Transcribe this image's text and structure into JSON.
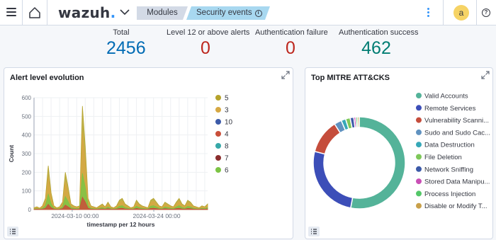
{
  "header": {
    "logo_text": "wazuh",
    "logo_dot": ".",
    "breadcrumbs": [
      "Modules",
      "Security events"
    ],
    "info_glyph": "i",
    "avatar_initial": "a",
    "help_glyph": "?",
    "brand_color": "#3595f9"
  },
  "stats": [
    {
      "label": "Total",
      "value": "2456",
      "color": "#006bb4"
    },
    {
      "label": "Level 12 or above alerts",
      "value": "0",
      "color": "#bd271e"
    },
    {
      "label": "Authentication failure",
      "value": "0",
      "color": "#bd271e"
    },
    {
      "label": "Authentication success",
      "value": "462",
      "color": "#017d73"
    }
  ],
  "alert_panel": {
    "title": "Alert level evolution"
  },
  "mitre_panel": {
    "title": "Top MITRE ATT&CKS"
  },
  "chart_data": [
    {
      "type": "area",
      "title": "Alert level evolution",
      "xlabel": "timestamp per 12 hours",
      "ylabel": "Count",
      "ylim": [
        0,
        600
      ],
      "y_ticks": [
        0,
        100,
        200,
        300,
        400,
        500,
        600
      ],
      "x_tick_labels": [
        "2024-03-10 00:00",
        "2024-03-24 00:00"
      ],
      "grid": true,
      "legend_position": "right",
      "legend": [
        {
          "name": "5",
          "color": "#b5a32c"
        },
        {
          "name": "3",
          "color": "#d6a843"
        },
        {
          "name": "10",
          "color": "#3c5aa8"
        },
        {
          "name": "4",
          "color": "#c94f3a"
        },
        {
          "name": "8",
          "color": "#36a8a8"
        },
        {
          "name": "7",
          "color": "#8b2e2e"
        },
        {
          "name": "6",
          "color": "#7cc444"
        }
      ],
      "x_count": 62,
      "spikes": [
        {
          "index": 5,
          "value": 235
        },
        {
          "index": 11,
          "value": 200
        },
        {
          "index": 17,
          "value": 555
        },
        {
          "index": 18,
          "value": 340
        }
      ],
      "series_top": [
        10,
        15,
        8,
        20,
        60,
        235,
        90,
        20,
        10,
        15,
        40,
        200,
        120,
        30,
        20,
        15,
        20,
        555,
        340,
        60,
        20,
        15,
        10,
        20,
        30,
        15,
        40,
        15,
        10,
        20,
        50,
        60,
        30,
        20,
        10,
        15,
        50,
        30,
        20,
        15,
        10,
        50,
        60,
        40,
        20,
        15,
        40,
        30,
        20,
        15,
        40,
        60,
        30,
        20,
        50,
        40,
        20,
        15,
        10,
        20,
        15,
        30
      ]
    },
    {
      "type": "pie",
      "title": "Top MITRE ATT&CKS",
      "donut": true,
      "legend_position": "right",
      "labels": [
        "Valid Accounts",
        "Remote Services",
        "Vulnerability Scanni...",
        "Sudo and Sudo Cac...",
        "Data Destruction",
        "File Deletion",
        "Network Sniffing",
        "Stored Data Manipu...",
        "Process Injection",
        "Disable or Modify T..."
      ],
      "values": [
        53,
        26,
        12,
        2.6,
        1.6,
        1.6,
        1.3,
        0.7,
        0.6,
        0.6
      ],
      "colors": [
        "#54b399",
        "#3c4eb8",
        "#c54d3c",
        "#6092c0",
        "#36a8b8",
        "#7ec85a",
        "#3c5aa8",
        "#c94fb5",
        "#53c768",
        "#c9a04a"
      ]
    }
  ]
}
